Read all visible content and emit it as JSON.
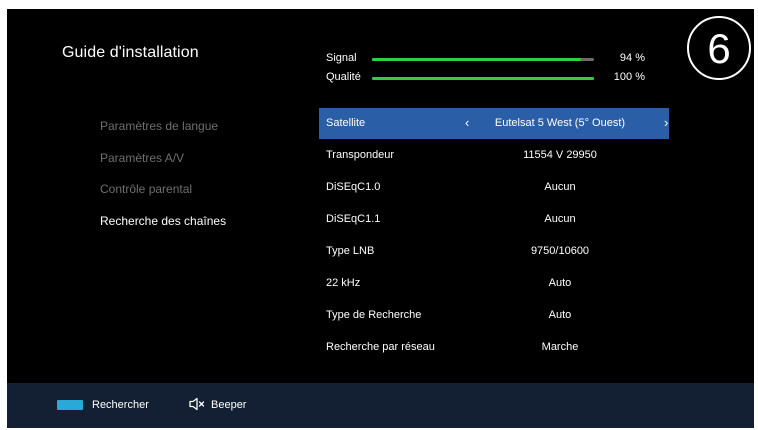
{
  "title": "Guide d'installation",
  "step_number": "6",
  "meters": [
    {
      "label": "Signal",
      "value": "94 %",
      "level": 0.94
    },
    {
      "label": "Qualité",
      "value": "100 %",
      "level": 1.0
    }
  ],
  "menu": [
    {
      "label": "Paramètres de langue",
      "active": false
    },
    {
      "label": "Paramètres A/V",
      "active": false
    },
    {
      "label": "Contrôle parental",
      "active": false
    },
    {
      "label": "Recherche des chaînes",
      "active": true
    }
  ],
  "settings": [
    {
      "label": "Satellite",
      "value": "Eutelsat 5 West (5° Ouest)",
      "selected": true,
      "left_arrow": "‹",
      "right_arrow": "›"
    },
    {
      "label": "Transpondeur",
      "value": "11554 V 29950"
    },
    {
      "label": "DiSEqC1.0",
      "value": "Aucun"
    },
    {
      "label": "DiSEqC1.1",
      "value": "Aucun"
    },
    {
      "label": "Type LNB",
      "value": "9750/10600"
    },
    {
      "label": "22 kHz",
      "value": "Auto"
    },
    {
      "label": "Type de Recherche",
      "value": "Auto"
    },
    {
      "label": "Recherche par réseau",
      "value": "Marche"
    }
  ],
  "footer": {
    "blue_key_color": "#29a9d8",
    "search_label": "Rechercher",
    "beeper_label": "Beeper",
    "mute_icon": "speaker-mute-icon"
  },
  "colors": {
    "background": "#000000",
    "selected_row": "#2a5ea6",
    "meter_fill": "#2fcf3f",
    "footer": "#132033"
  }
}
